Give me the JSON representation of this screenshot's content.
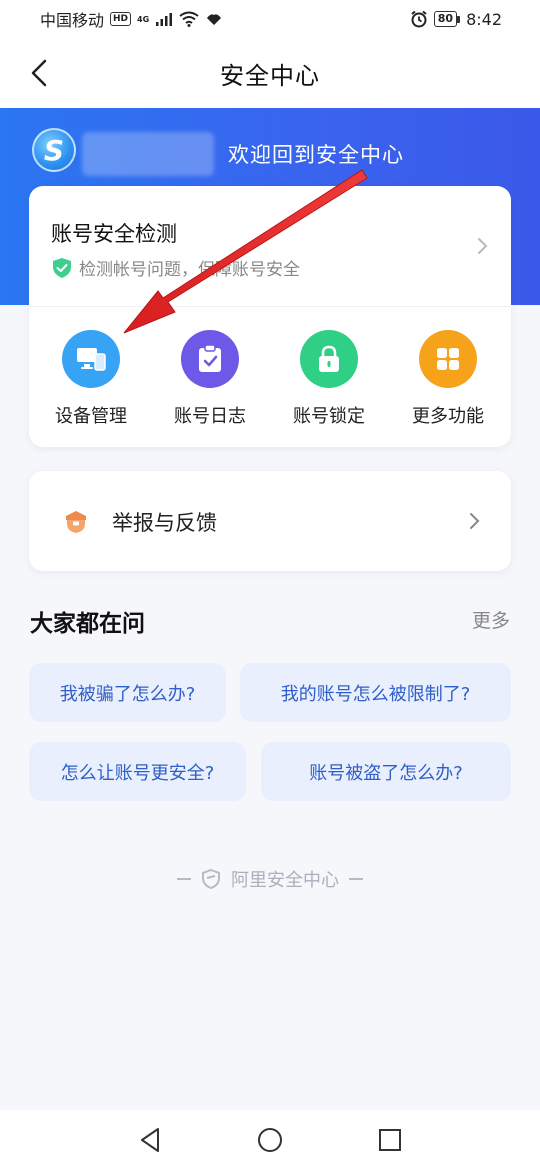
{
  "status_bar": {
    "carrier": "中国移动",
    "hd": "HD",
    "network": "4G",
    "battery": "80",
    "time": "8:42"
  },
  "nav": {
    "title": "安全中心",
    "back_icon": "chevron-left-icon"
  },
  "banner": {
    "welcome": "欢迎回到安全中心",
    "logo_letter": "S"
  },
  "detect": {
    "title": "账号安全检测",
    "subtitle": "检测帐号问题，保障账号安全"
  },
  "functions": [
    {
      "label": "设备管理",
      "icon": "devices-icon",
      "color": "#37a3f4"
    },
    {
      "label": "账号日志",
      "icon": "clipboard-check-icon",
      "color": "#6c59e8"
    },
    {
      "label": "账号锁定",
      "icon": "lock-icon",
      "color": "#2fcf86"
    },
    {
      "label": "更多功能",
      "icon": "grid-icon",
      "color": "#f7a21b"
    }
  ],
  "report": {
    "label": "举报与反馈",
    "icon": "police-badge-icon"
  },
  "faq": {
    "title": "大家都在问",
    "more": "更多",
    "questions": [
      "我被骗了怎么办?",
      "我的账号怎么被限制了?",
      "怎么让账号更安全?",
      "账号被盗了怎么办?"
    ]
  },
  "footer": {
    "brand": "阿里安全中心"
  },
  "colors": {
    "accent": "#3a63ee",
    "annotation_arrow": "#e02a2a"
  }
}
